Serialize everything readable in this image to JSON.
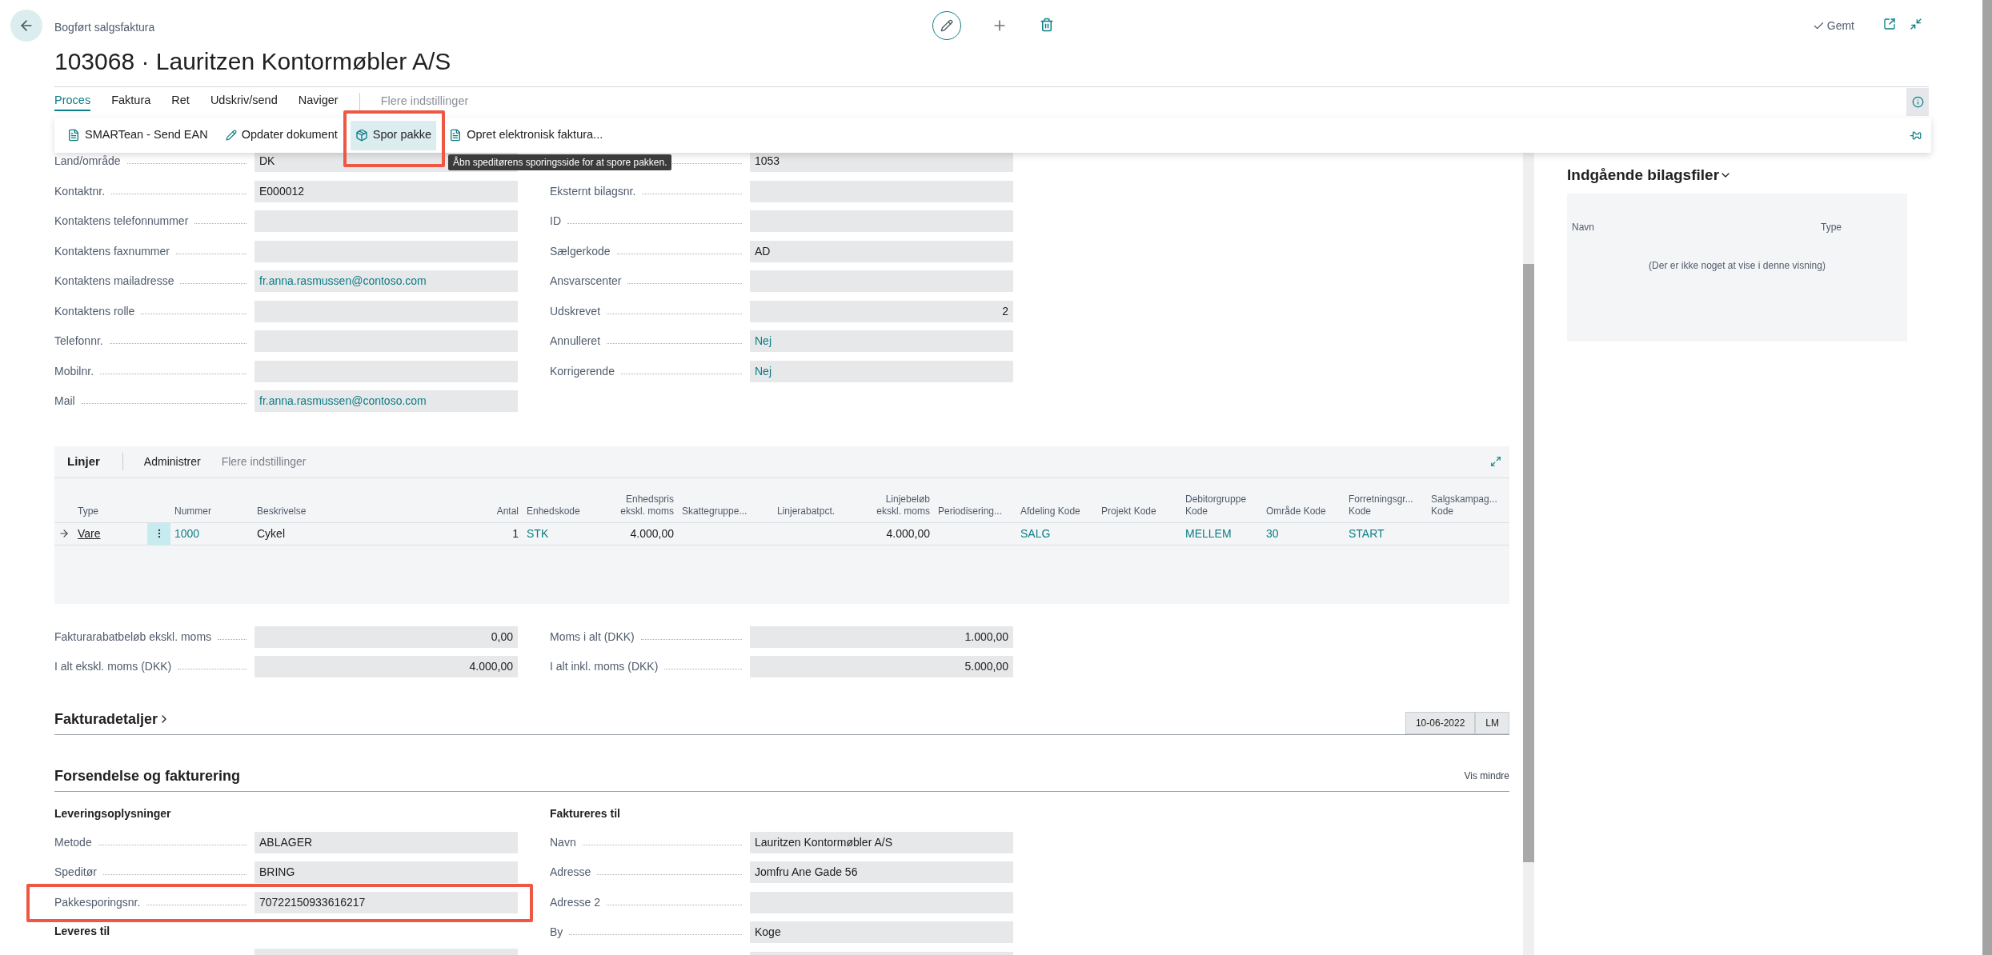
{
  "header": {
    "breadcrumb": "Bogført salgsfaktura",
    "title": "103068 · Lauritzen Kontormøbler A/S",
    "status": "Gemt"
  },
  "tabs": [
    {
      "label": "Proces",
      "selected": true
    },
    {
      "label": "Faktura",
      "selected": false
    },
    {
      "label": "Ret",
      "selected": false
    },
    {
      "label": "Udskriv/send",
      "selected": false
    },
    {
      "label": "Naviger",
      "selected": false
    }
  ],
  "more_options": "Flere indstillinger",
  "actions": [
    {
      "label": "SMARTean - Send EAN",
      "kind": "document",
      "selected": false,
      "highlighted": false
    },
    {
      "label": "Opdater dokument",
      "kind": "edit",
      "selected": false,
      "highlighted": false
    },
    {
      "label": "Spor pakke",
      "kind": "tracking",
      "selected": true,
      "highlighted": true
    },
    {
      "label": "Opret elektronisk faktura...",
      "kind": "document",
      "selected": false,
      "highlighted": false
    }
  ],
  "tooltip": "Åbn speditørens sporingsside for at spore pakken.",
  "general": {
    "left": [
      {
        "label": "Land/område",
        "value": "DK",
        "kind": "text"
      },
      {
        "label": "Kontaktnr.",
        "value": "E000012",
        "kind": "text"
      },
      {
        "label": "Kontaktens telefonnummer",
        "kind": "text"
      },
      {
        "label": "Kontaktens faxnummer",
        "kind": "text"
      },
      {
        "label": "Kontaktens mailadresse",
        "value": "fr.anna.rasmussen@contoso.com",
        "kind": "link"
      },
      {
        "label": "Kontaktens rolle",
        "kind": "text"
      },
      {
        "label": "Telefonnr.",
        "kind": "text"
      },
      {
        "label": "Mobilnr.",
        "kind": "text"
      },
      {
        "label": "Mail",
        "value": "fr.anna.rasmussen@contoso.com",
        "kind": "link"
      }
    ],
    "right": [
      {
        "value": "1053",
        "kind": "text"
      },
      {
        "label": "Eksternt bilagsnr.",
        "kind": "text"
      },
      {
        "label": "ID",
        "kind": "text"
      },
      {
        "label": "Sælgerkode",
        "value": "AD",
        "kind": "text"
      },
      {
        "label": "Ansvarscenter",
        "kind": "text"
      },
      {
        "label": "Udskrevet",
        "value": "2",
        "kind": "number"
      },
      {
        "label": "Annulleret",
        "value": "Nej",
        "kind": "link"
      },
      {
        "label": "Korrigerende",
        "value": "Nej",
        "kind": "link"
      }
    ]
  },
  "lines": {
    "title": "Linjer",
    "actions": [
      {
        "label": "Administrer",
        "disabled": false
      },
      {
        "label": "Flere indstillinger",
        "disabled": true
      }
    ],
    "columns": [
      {
        "label": "Type",
        "kind": "text"
      },
      {
        "label": "Nummer",
        "kind": "text"
      },
      {
        "label": "Beskrivelse",
        "kind": "text"
      },
      {
        "label": "Antal",
        "kind": "number"
      },
      {
        "label": "Enhedskode",
        "kind": "text"
      },
      {
        "label": "Enhedspris\nekskl. moms",
        "kind": "number"
      },
      {
        "label": "Skattegruppe...",
        "kind": "text"
      },
      {
        "label": "Linjerabatpct.",
        "kind": "text"
      },
      {
        "label": "Linjebeløb\nekskl. moms",
        "kind": "number"
      },
      {
        "label": "Periodisering...",
        "kind": "text"
      },
      {
        "label": "Afdeling Kode",
        "kind": "text"
      },
      {
        "label": "Projekt Kode",
        "kind": "text"
      },
      {
        "label": "Debitorgruppe\nKode",
        "kind": "text"
      },
      {
        "label": "Område Kode",
        "kind": "text"
      },
      {
        "label": "Forretningsgr...\nKode",
        "kind": "text"
      },
      {
        "label": "Salgskampag...\nKode",
        "kind": "text"
      }
    ],
    "rows": [
      {
        "current": true,
        "cells": [
          {
            "text": "Vare",
            "kind": "underlined"
          },
          {
            "text": "1000",
            "kind": "link"
          },
          {
            "text": "Cykel",
            "kind": "text"
          },
          {
            "text": "1",
            "kind": "text"
          },
          {
            "text": "STK",
            "kind": "link"
          },
          {
            "text": "4.000,00",
            "kind": "text"
          },
          null,
          null,
          {
            "text": "4.000,00",
            "kind": "text"
          },
          null,
          {
            "text": "SALG",
            "kind": "link"
          },
          null,
          {
            "text": "MELLEM",
            "kind": "link"
          },
          {
            "text": "30",
            "kind": "link"
          },
          {
            "text": "START",
            "kind": "link"
          },
          null
        ]
      }
    ]
  },
  "totals": {
    "left": [
      {
        "label": "Fakturarabatbeløb ekskl. moms",
        "value": "0,00",
        "kind": "number"
      },
      {
        "label": "I alt ekskl. moms (DKK)",
        "value": "4.000,00",
        "kind": "number"
      }
    ],
    "right": [
      {
        "label": "Moms i alt (DKK)",
        "value": "1.000,00",
        "kind": "number"
      },
      {
        "label": "I alt inkl. moms (DKK)",
        "value": "5.000,00",
        "kind": "number"
      }
    ]
  },
  "invoice_details": {
    "title": "Fakturadetaljer",
    "expanded": false,
    "badges": [
      "10-06-2022",
      "LM"
    ]
  },
  "shipping": {
    "title": "Forsendelse og fakturering",
    "toggle": "Vis mindre",
    "left": [
      {
        "kind": "heading",
        "label": "Leveringsoplysninger"
      },
      {
        "label": "Metode",
        "value": "ABLAGER",
        "kind": "text"
      },
      {
        "label": "Speditør",
        "value": "BRING",
        "kind": "text"
      },
      {
        "label": "Pakkesporingsnr.",
        "value": "70722150933616217",
        "kind": "text",
        "highlighted": true
      },
      {
        "kind": "heading",
        "label": "Leveres til"
      },
      {
        "kind": "text"
      }
    ],
    "right": [
      {
        "kind": "heading",
        "label": "Faktureres til"
      },
      {
        "label": "Navn",
        "value": "Lauritzen Kontormøbler A/S",
        "kind": "text"
      },
      {
        "label": "Adresse",
        "value": "Jomfru Ane Gade 56",
        "kind": "text"
      },
      {
        "label": "Adresse 2",
        "kind": "text"
      },
      {
        "label": "By",
        "value": "Koge",
        "kind": "text"
      },
      {
        "kind": "text"
      }
    ]
  },
  "factbox": {
    "title": "Indgående bilagsfiler",
    "expanded": true,
    "columns": [
      "Navn",
      "Type"
    ],
    "empty_text": "(Der er ikke noget at vise i denne visning)"
  }
}
